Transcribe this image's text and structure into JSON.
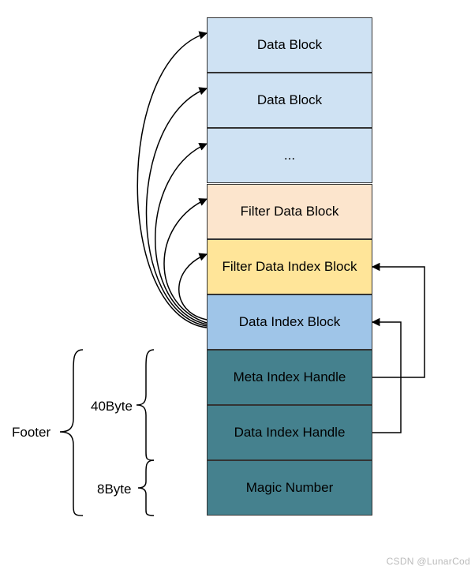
{
  "blocks": {
    "data_block_1": "Data Block",
    "data_block_2": "Data Block",
    "data_block_ellipsis": "...",
    "filter_data_block": "Filter Data Block",
    "filter_data_index_block": "Filter Data Index Block",
    "data_index_block": "Data Index Block",
    "meta_index_handle": "Meta Index Handle",
    "data_index_handle": "Data Index Handle",
    "magic_number": "Magic Number"
  },
  "labels": {
    "footer": "Footer",
    "size_40": "40Byte",
    "size_8": "8Byte"
  },
  "watermark": "CSDN @LunarCod"
}
